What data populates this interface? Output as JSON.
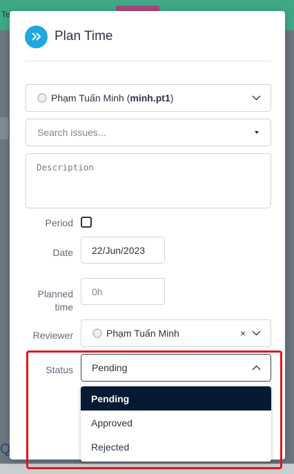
{
  "background": {
    "top_text": "Te",
    "left_text": "QA"
  },
  "modal": {
    "title": "Plan Time",
    "header_icon": "double-chevron-right-icon"
  },
  "user_select": {
    "name": "Phạm Tuấn Minh",
    "username": "minh.pt1"
  },
  "issue_search": {
    "placeholder": "Search issues..."
  },
  "description": {
    "placeholder": "Description"
  },
  "period": {
    "label": "Period",
    "checked": false
  },
  "date": {
    "label": "Date",
    "value": "22/Jun/2023"
  },
  "planned_time": {
    "label_line1": "Planned",
    "label_line2": "time",
    "placeholder": "0h"
  },
  "reviewer": {
    "label": "Reviewer",
    "name": "Phạm Tuấn Minh",
    "clear": "×"
  },
  "status": {
    "label": "Status",
    "value": "Pending",
    "options": [
      "Pending",
      "Approved",
      "Rejected"
    ]
  },
  "colors": {
    "accent": "#1fa8e0",
    "selected_option_bg": "#071a33",
    "highlight_border": "#e3141c"
  }
}
